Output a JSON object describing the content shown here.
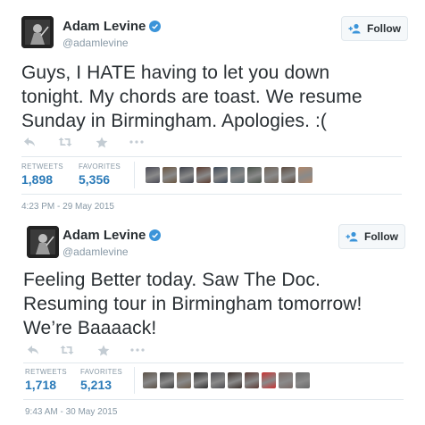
{
  "tweets": [
    {
      "name": "Adam Levine",
      "handle": "@adamlevine",
      "follow_label": "Follow",
      "text": "Guys, I HATE having to let you down\ntonight. My chords are toast. We resume\nSunday in Birmingham. Apologies. :(",
      "retweets_label": "RETWEETS",
      "retweets": "1,898",
      "favorites_label": "FAVORITES",
      "favorites": "5,356",
      "timestamp": "4:23 PM - 29 May 2015",
      "favoriter_colors": [
        "#4a4a55",
        "#6a5540",
        "#3c3f48",
        "#5a3a2e",
        "#3b4756",
        "#58646a",
        "#485048",
        "#706459",
        "#5b4a3e",
        "#b0876a"
      ]
    },
    {
      "name": "Adam Levine",
      "handle": "@adamlevine",
      "follow_label": "Follow",
      "text": "Feeling Better today. Saw The Doc.\nResuming tour in Birmingham tomorrow!\nWe’re Baaaack!",
      "retweets_label": "RETWEETS",
      "retweets": "1,718",
      "favorites_label": "FAVORITES",
      "favorites": "5,213",
      "timestamp": "9:43 AM - 30 May 2015",
      "favoriter_colors": [
        "#5a5046",
        "#3f3f3f",
        "#6b5a4a",
        "#2e2e2e",
        "#4e4e52",
        "#3a2f2a",
        "#5a3a34",
        "#c83232",
        "#7a6a66",
        "#6a6a6a"
      ]
    }
  ],
  "icons": {
    "verified": "verified-badge-icon",
    "follow": "add-user-icon",
    "reply": "reply-icon",
    "retweet": "retweet-icon",
    "favorite": "star-icon",
    "more": "more-dots-icon"
  },
  "colors": {
    "verified_blue": "#3b94d9",
    "stat_blue": "#2a7ab8",
    "muted": "#8899a6",
    "border": "#e1e8ed"
  }
}
